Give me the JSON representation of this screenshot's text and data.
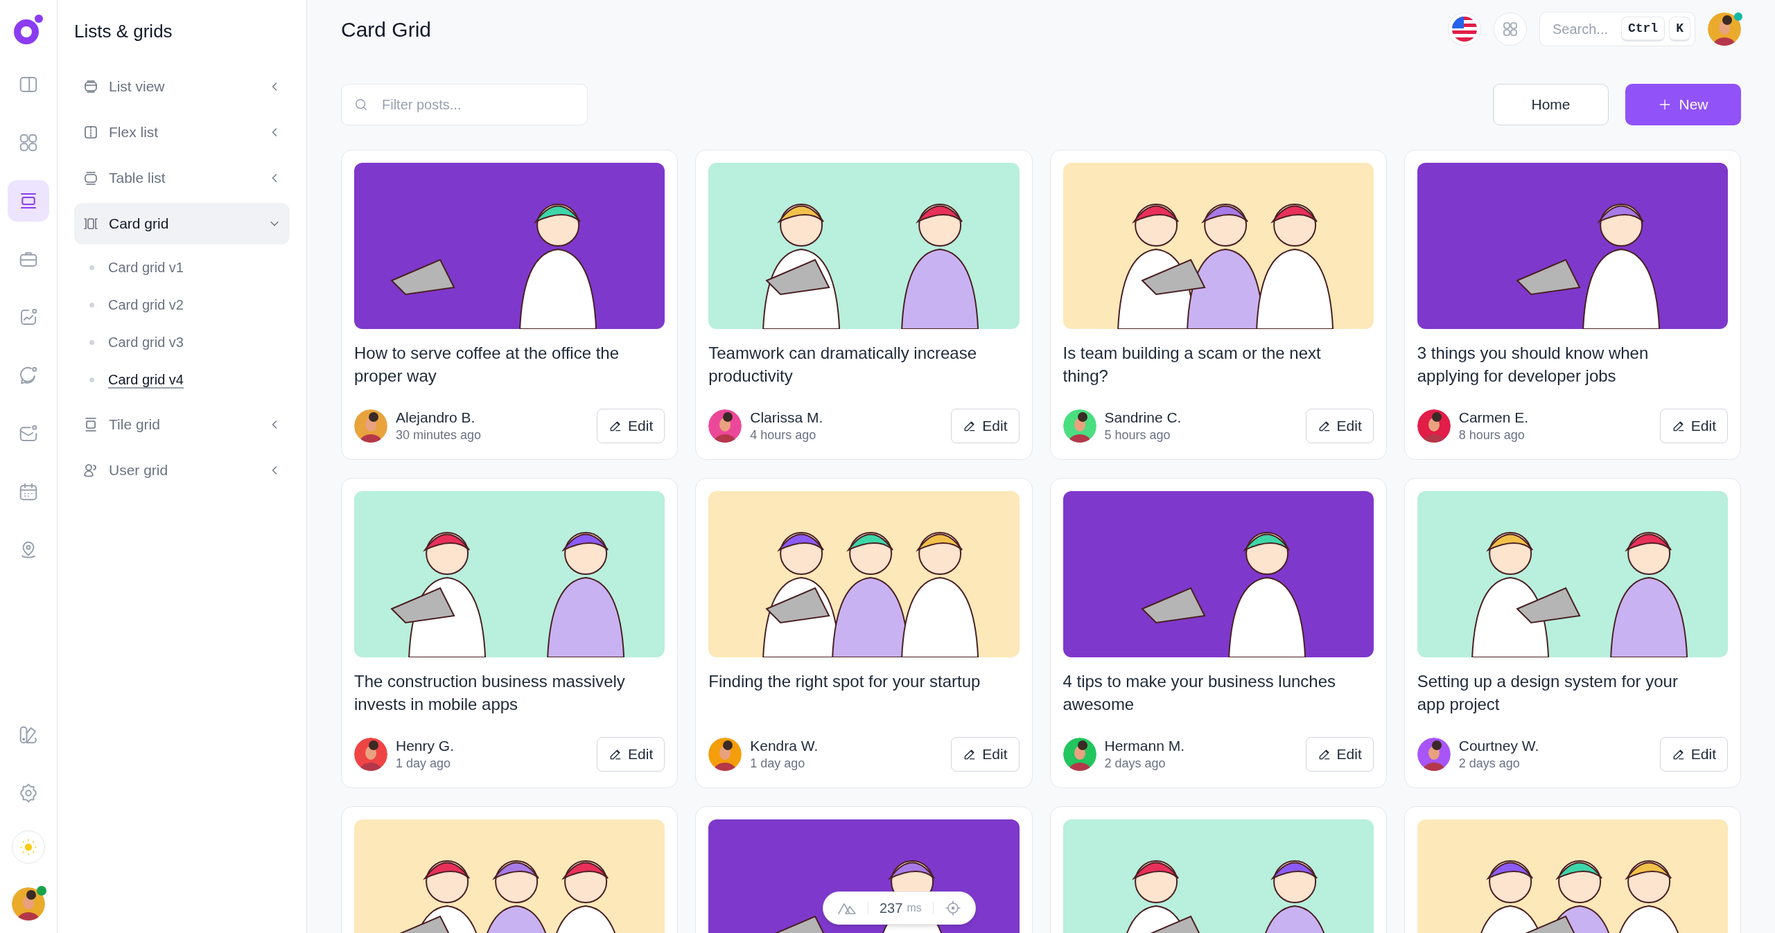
{
  "rail": {
    "items": [
      {
        "selected": false
      },
      {
        "selected": false
      },
      {
        "selected": true
      },
      {
        "selected": false
      },
      {
        "selected": false
      },
      {
        "selected": false
      },
      {
        "selected": false
      },
      {
        "selected": false
      },
      {
        "selected": false
      }
    ],
    "bottom_items": [
      {
        "selected": false
      },
      {
        "selected": false
      }
    ]
  },
  "sidebar": {
    "title": "Lists & grids",
    "items": [
      {
        "label": "List view",
        "expanded": false
      },
      {
        "label": "Flex list",
        "expanded": false
      },
      {
        "label": "Table list",
        "expanded": false
      },
      {
        "label": "Card grid",
        "expanded": true,
        "children": [
          {
            "label": "Card grid v1",
            "selected": false
          },
          {
            "label": "Card grid v2",
            "selected": false
          },
          {
            "label": "Card grid v3",
            "selected": false
          },
          {
            "label": "Card grid v4",
            "selected": true
          }
        ]
      },
      {
        "label": "Tile grid",
        "expanded": false
      },
      {
        "label": "User grid",
        "expanded": false
      }
    ]
  },
  "header": {
    "title": "Card Grid",
    "search": {
      "placeholder": "Search...",
      "keys": [
        "Ctrl",
        "K"
      ]
    }
  },
  "toolbar": {
    "filter": {
      "placeholder": "Filter posts..."
    },
    "buttons": [
      "Home",
      "New"
    ]
  },
  "cards": [
    {
      "kind": "post",
      "title": "How to serve coffee at the office the proper way",
      "author": "Alejandro B.",
      "time": "30 minutes ago",
      "color": "#e8a33d",
      "action": "Edit"
    },
    {
      "kind": "post",
      "title": "Teamwork can dramatically increase productivity",
      "author": "Clarissa M.",
      "time": "4 hours ago",
      "color": "#ec4899",
      "action": "Edit"
    },
    {
      "kind": "post",
      "title": "Is team building a scam or the next thing?",
      "author": "Sandrine C.",
      "time": "5 hours ago",
      "color": "#4ade80",
      "action": "Edit"
    },
    {
      "kind": "post",
      "title": "3 things you should know when applying for developer jobs",
      "author": "Carmen E.",
      "time": "8 hours ago",
      "color": "#e11d48",
      "action": "Edit"
    },
    {
      "kind": "post",
      "title": "The construction business massively invests in mobile apps",
      "author": "Henry G.",
      "time": "1 day ago",
      "color": "#ef4444",
      "action": "Edit"
    },
    {
      "kind": "post",
      "title": "Finding the right spot for your startup",
      "author": "Kendra W.",
      "time": "1 day ago",
      "color": "#f59e0b",
      "action": "Edit"
    },
    {
      "kind": "post",
      "title": "4 tips to make your business lunches awesome",
      "author": "Hermann M.",
      "time": "2 days ago",
      "color": "#22c55e",
      "action": "Edit"
    },
    {
      "kind": "post",
      "title": "Setting up a design system for your app project",
      "author": "Courtney W.",
      "time": "2 days ago",
      "color": "#a855f7",
      "action": "Edit"
    },
    {
      "kind": "picture"
    },
    {
      "kind": "picture"
    },
    {
      "kind": "picture"
    },
    {
      "kind": "picture"
    }
  ],
  "perf_badge": {
    "value": "237",
    "unit": "ms"
  }
}
